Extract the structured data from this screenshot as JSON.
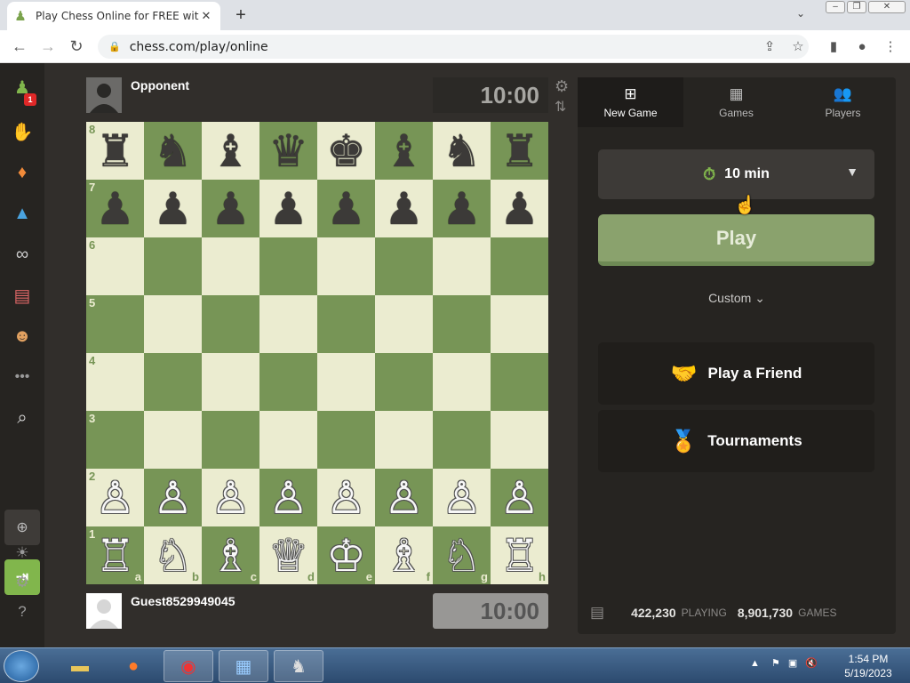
{
  "browser": {
    "tab_title": "Play Chess Online for FREE with F",
    "url": "chess.com/play/online"
  },
  "sidebar": {
    "notification_count": "1"
  },
  "board": {
    "top_player": {
      "name": "Opponent",
      "clock": "10:00"
    },
    "bottom_player": {
      "name": "Guest8529949045",
      "clock": "10:00"
    },
    "rank_labels": [
      "8",
      "7",
      "6",
      "5",
      "4",
      "3",
      "2",
      "1"
    ],
    "file_labels": [
      "a",
      "b",
      "c",
      "d",
      "e",
      "f",
      "g",
      "h"
    ],
    "position": [
      [
        "♜",
        "♞",
        "♝",
        "♛",
        "♚",
        "♝",
        "♞",
        "♜"
      ],
      [
        "♟",
        "♟",
        "♟",
        "♟",
        "♟",
        "♟",
        "♟",
        "♟"
      ],
      [
        "",
        "",
        "",
        "",
        "",
        "",
        "",
        ""
      ],
      [
        "",
        "",
        "",
        "",
        "",
        "",
        "",
        ""
      ],
      [
        "",
        "",
        "",
        "",
        "",
        "",
        "",
        ""
      ],
      [
        "",
        "",
        "",
        "",
        "",
        "",
        "",
        ""
      ],
      [
        "♙",
        "♙",
        "♙",
        "♙",
        "♙",
        "♙",
        "♙",
        "♙"
      ],
      [
        "♖",
        "♘",
        "♗",
        "♕",
        "♔",
        "♗",
        "♘",
        "♖"
      ]
    ]
  },
  "panel": {
    "tabs": [
      {
        "label": "New Game",
        "icon": "plus-square-icon"
      },
      {
        "label": "Games",
        "icon": "checkerboard-icon"
      },
      {
        "label": "Players",
        "icon": "players-icon"
      }
    ],
    "time_control": "10 min",
    "play_label": "Play",
    "custom_label": "Custom",
    "play_friend_label": "Play a Friend",
    "tournaments_label": "Tournaments",
    "stats": {
      "playing_count": "422,230",
      "playing_label": "PLAYING",
      "games_count": "8,901,730",
      "games_label": "GAMES"
    }
  },
  "taskbar": {
    "time": "1:54 PM",
    "date": "5/19/2023"
  },
  "colors": {
    "board_light": "#ebecd0",
    "board_dark": "#779556",
    "accent_green": "#81b64c",
    "background": "#312e2b"
  }
}
